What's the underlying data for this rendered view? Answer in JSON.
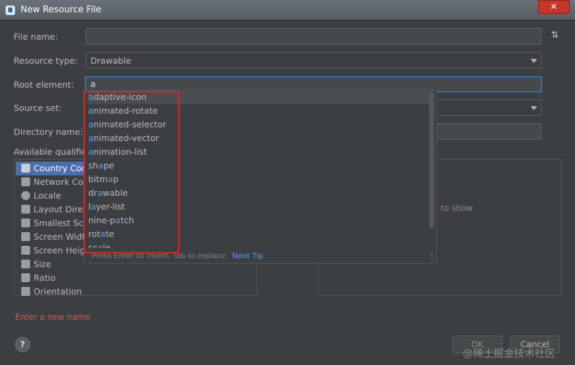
{
  "window": {
    "title": "New Resource File",
    "close_label": "✕"
  },
  "form": {
    "file_name_label": "File name:",
    "file_name_value": "",
    "resource_type_label": "Resource type:",
    "resource_type_value": "Drawable",
    "root_element_label": "Root element:",
    "root_element_value": "a",
    "source_set_label": "Source set:",
    "directory_name_label": "Directory name:",
    "available_qualifiers_label": "Available qualifie",
    "sort_icon": "⇅"
  },
  "qualifiers": [
    {
      "label": "Country Cod",
      "icon": "country-icon"
    },
    {
      "label": "Network Coc",
      "icon": "network-icon"
    },
    {
      "label": "Locale",
      "icon": "globe-icon"
    },
    {
      "label": "Layout Direc",
      "icon": "layout-direction-icon"
    },
    {
      "label": "Smallest Scre",
      "icon": "smallest-screen-icon"
    },
    {
      "label": "Screen Width",
      "icon": "screen-width-icon"
    },
    {
      "label": "Screen Heigh",
      "icon": "screen-height-icon"
    },
    {
      "label": "Size",
      "icon": "size-icon"
    },
    {
      "label": "Ratio",
      "icon": "ratio-icon"
    },
    {
      "label": "Orientation",
      "icon": "orientation-icon"
    }
  ],
  "right_panel": {
    "empty_text": "to show"
  },
  "popup": {
    "items": [
      {
        "pre": "",
        "hl": "a",
        "post": "daptive-icon"
      },
      {
        "pre": "",
        "hl": "a",
        "post": "nimated-rotate"
      },
      {
        "pre": "",
        "hl": "a",
        "post": "nimated-selector"
      },
      {
        "pre": "",
        "hl": "a",
        "post": "nimated-vector"
      },
      {
        "pre": "",
        "hl": "a",
        "post": "nimation-list"
      },
      {
        "pre": "sh",
        "hl": "a",
        "post": "pe"
      },
      {
        "pre": "bitm",
        "hl": "a",
        "post": "p"
      },
      {
        "pre": "dr",
        "hl": "a",
        "post": "wable"
      },
      {
        "pre": "l",
        "hl": "a",
        "post": "yer-list"
      },
      {
        "pre": "nine-p",
        "hl": "a",
        "post": "tch"
      },
      {
        "pre": "rot",
        "hl": "a",
        "post": "te"
      },
      {
        "pre": "sc",
        "hl": "a",
        "post": "le"
      }
    ],
    "footer_text": "Press Enter to insert, Tab to replace",
    "footer_link": "Next Tip",
    "menu_dots": "⋮"
  },
  "error_text": "Enter a new name",
  "buttons": {
    "help": "?",
    "ok": "OK",
    "cancel": "Cancel"
  },
  "watermark": "@稀土掘金技术社区",
  "colors": {
    "background": "#3c3f41",
    "selection": "#4b6eaf",
    "accent_border": "#3d6ea8",
    "highlight": "#5a9fe5",
    "error": "#e0524a",
    "annotation_red": "#d82a2a"
  }
}
